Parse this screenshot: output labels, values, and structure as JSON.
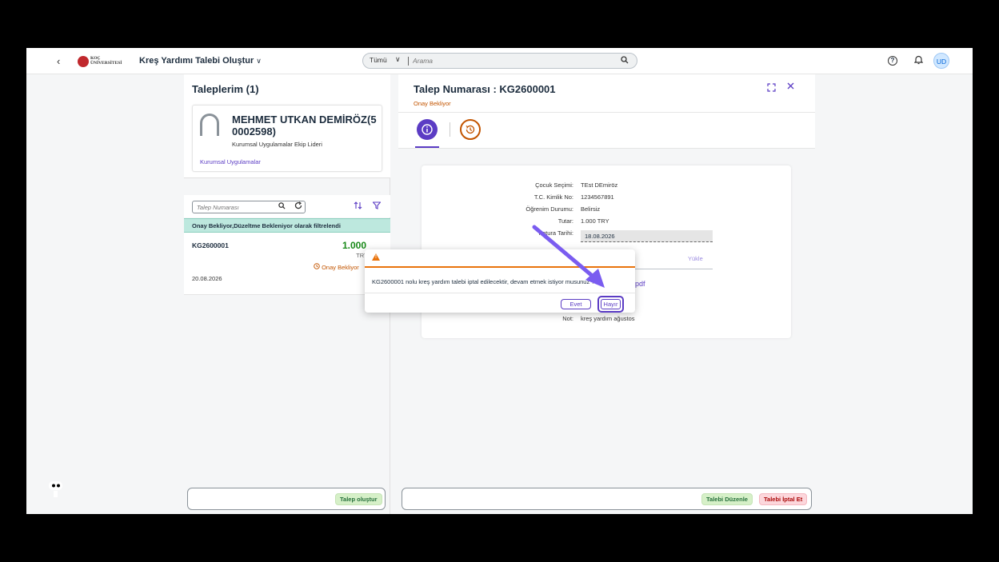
{
  "shell": {
    "back": "‹",
    "logo_text_line1": "KOÇ",
    "logo_text_line2": "ÜNİVERSİTESİ",
    "app_title": "Kreş Yardımı Talebi Oluştur",
    "app_title_chevron": "∨",
    "search_scope": "Tümü",
    "search_scope_chevron": "∨",
    "search_placeholder": "Arama",
    "help": "?",
    "avatar": "UD"
  },
  "left": {
    "title": "Taleplerim (1)",
    "profile": {
      "name": "MEHMET UTKAN DEMİRÖZ(5 0002598)",
      "role": "Kurumsal Uygulamalar Ekip Lideri",
      "department": "Kurumsal Uygulamalar"
    },
    "filter_placeholder": "Talep Numarası",
    "info_bar": "Onay Bekliyor,Düzeltme Bekleniyor olarak filtrelendi",
    "items": [
      {
        "id": "KG2600001",
        "amount": "1.000",
        "currency": "TRY",
        "status": "Onay Bekliyor",
        "date": "20.08.2026"
      }
    ],
    "create_button": "Talep oluştur"
  },
  "right": {
    "title": "Talep Numarası : KG2600001",
    "status": "Onay Bekliyor",
    "fields": [
      {
        "label": "Çocuk Seçimi:",
        "value": "TEst DEmiröz"
      },
      {
        "label": "T.C. Kimlik No:",
        "value": "1234567891"
      },
      {
        "label": "Öğrenim Durumu:",
        "value": "Belirsiz"
      },
      {
        "label": "Tutar:",
        "value": "1.000 TRY"
      }
    ],
    "invoice_date_label": "Fatura Tarihi:",
    "invoice_date_value": "18.08.2026",
    "upload_link": "Yükle",
    "attachment_suffix": "pdf",
    "note_label": "Not:",
    "note_value": "kreş yardım ağustos",
    "edit_button": "Talebi Düzenle",
    "cancel_button": "Talebi İptal Et"
  },
  "dialog": {
    "message": "KG2600001 nolu kreş yardım talebi iptal edilecektir, devam etmek istiyor musunuz ?",
    "yes_button": "Evet",
    "no_button": "Hayır"
  },
  "colors": {
    "brand": "#5b3cc4",
    "warning": "#e9730c",
    "positive": "#188918",
    "pending": "#c35500"
  }
}
